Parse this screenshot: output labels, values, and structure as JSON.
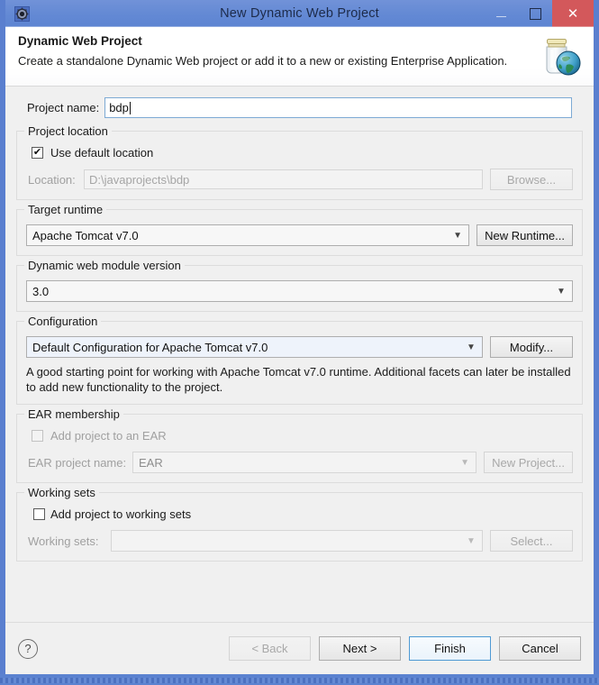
{
  "window": {
    "title": "New Dynamic Web Project",
    "icon": "gear-icon",
    "minimize_label": "–",
    "maximize_label": "□",
    "close_label": "✕"
  },
  "header": {
    "title": "Dynamic Web Project",
    "description": "Create a standalone Dynamic Web project or add it to a new or existing Enterprise Application.",
    "icon": "jar-globe-icon"
  },
  "form": {
    "project_name": {
      "label": "Project name:",
      "value": "bdp",
      "placeholder": ""
    },
    "project_location": {
      "group_title": "Project location",
      "use_default_label": "Use default location",
      "use_default_checked": true,
      "checkmark": "✔",
      "location_label": "Location:",
      "location_value": "D:\\javaprojects\\bdp",
      "browse_label": "Browse..."
    },
    "target_runtime": {
      "group_title": "Target runtime",
      "value": "Apache Tomcat v7.0",
      "new_runtime_label": "New Runtime..."
    },
    "module_version": {
      "group_title": "Dynamic web module version",
      "value": "3.0"
    },
    "configuration": {
      "group_title": "Configuration",
      "value": "Default Configuration for Apache Tomcat v7.0",
      "modify_label": "Modify...",
      "description": "A good starting point for working with Apache Tomcat v7.0 runtime. Additional facets can later be installed to add new functionality to the project."
    },
    "ear_membership": {
      "group_title": "EAR membership",
      "add_to_ear_label": "Add project to an EAR",
      "add_to_ear_checked": false,
      "ear_project_label": "EAR project name:",
      "ear_project_value": "EAR",
      "new_project_label": "New Project..."
    },
    "working_sets": {
      "group_title": "Working sets",
      "add_to_working_sets_label": "Add project to working sets",
      "add_to_working_sets_checked": false,
      "working_sets_label": "Working sets:",
      "working_sets_value": "",
      "select_label": "Select..."
    }
  },
  "footer": {
    "help_label": "?",
    "back_label": "< Back",
    "next_label": "Next >",
    "finish_label": "Finish",
    "cancel_label": "Cancel"
  },
  "colors": {
    "titlebar": "#6389d4",
    "close_button": "#d3585b",
    "frame": "#5a7fcf",
    "focus_outline": "#4e9ad4",
    "field_border": "#7daad4"
  }
}
